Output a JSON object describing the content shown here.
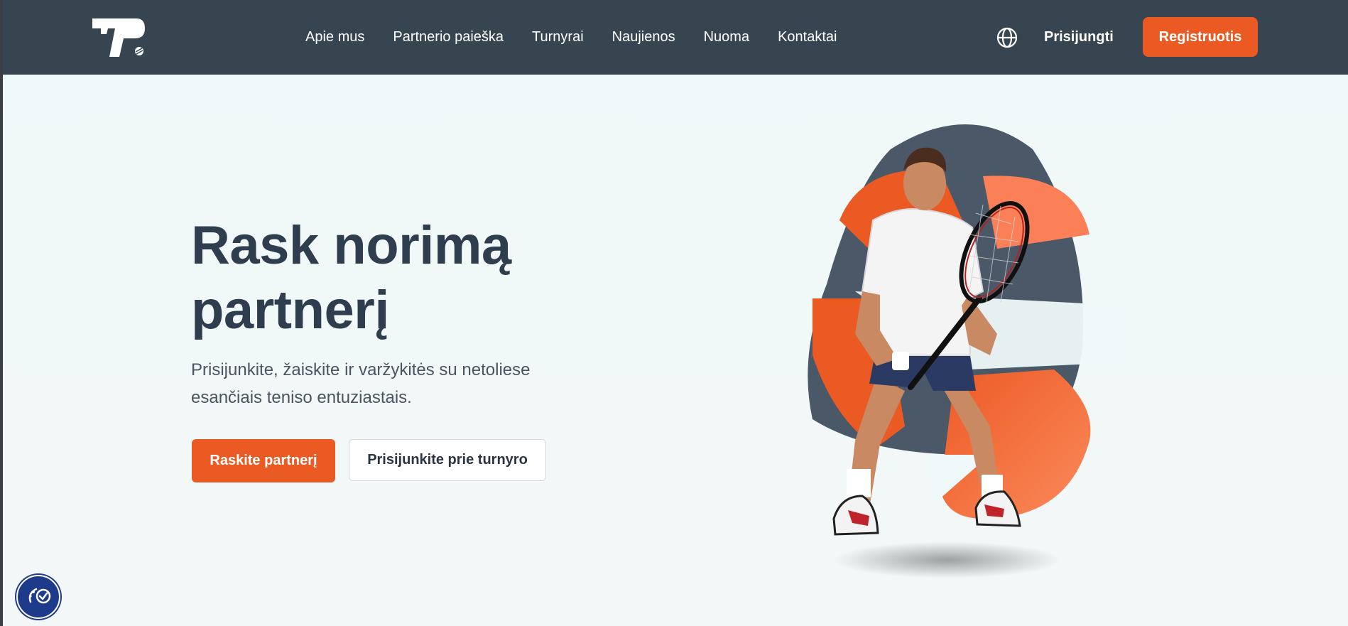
{
  "header": {
    "logo_text": "TP",
    "nav": [
      {
        "label": "Apie mus"
      },
      {
        "label": "Partnerio paieška"
      },
      {
        "label": "Turnyrai"
      },
      {
        "label": "Naujienos"
      },
      {
        "label": "Nuoma"
      },
      {
        "label": "Kontaktai"
      }
    ],
    "login_label": "Prisijungti",
    "register_label": "Registruotis"
  },
  "hero": {
    "title_line1": "Rask norimą",
    "title_line2": "partnerį",
    "subtitle_line1": "Prisijunkite, žaiskite ir varžykitės su netoliese",
    "subtitle_line2": "esančiais teniso entuziastais.",
    "primary_cta": "Raskite partnerį",
    "secondary_cta": "Prisijunkite prie turnyro"
  },
  "icons": {
    "language": "globe-icon",
    "accessibility": "accessibility-icon"
  },
  "colors": {
    "header_bg": "#36454f",
    "accent": "#ec5a24",
    "title": "#2f3e4e",
    "page_bg": "#eff9f9"
  }
}
